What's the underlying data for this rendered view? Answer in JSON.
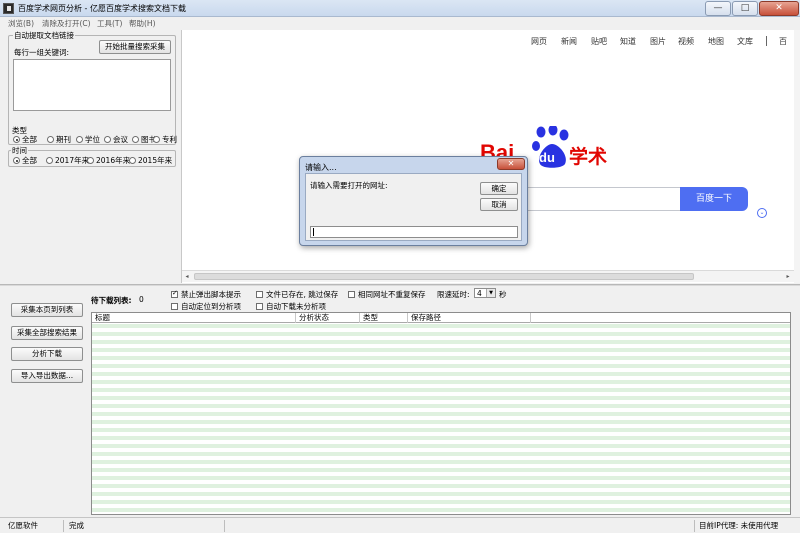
{
  "window": {
    "title": "百度学术网页分析 - 亿愿百度学术搜索文档下载",
    "minimize_glyph": "—",
    "maximize_glyph": "□",
    "close_glyph": "✕"
  },
  "menu": {
    "items": [
      "浏览(B)",
      "清除及打开(C)",
      "工具(T)",
      "帮助(H)"
    ]
  },
  "keyword_group": {
    "title": "自动提取文档链接",
    "label": "每行一组关键词:",
    "start_button": "开始批量搜索采集",
    "keywords_value": ""
  },
  "type_group": {
    "title": "类型",
    "options": [
      "全部",
      "期刊",
      "学位",
      "会议",
      "图书",
      "专利"
    ],
    "selected": "全部"
  },
  "time_group": {
    "title": "时间",
    "options": [
      "全部",
      "2017年来",
      "2016年来",
      "2015年来"
    ],
    "selected": "全部"
  },
  "browser": {
    "nav_links": [
      "网页",
      "新闻",
      "贴吧",
      "知道",
      "图片",
      "视频",
      "地图",
      "文库"
    ],
    "search_button": "百度一下",
    "logo_text_left": "Bai",
    "logo_text_paw": "du",
    "logo_text_right": "学术",
    "cut_link": "百"
  },
  "dialog": {
    "title": "请输入...",
    "prompt": "请输入需要打开的网址:",
    "ok": "确定",
    "cancel": "取消",
    "url_value": ""
  },
  "bottom": {
    "pending_label": "待下载列表:",
    "pending_count": "0",
    "buttons": [
      "采集本页到列表",
      "采集全部搜索结果",
      "分析下载",
      "导入导出数据..."
    ],
    "checkboxes": [
      {
        "label": "禁止弹出脚本提示",
        "checked": true
      },
      {
        "label": "文件已存在, 跳过保存",
        "checked": false
      },
      {
        "label": "相同网址不重复保存",
        "checked": false
      },
      {
        "label": "自动定位到分析项",
        "checked": false
      },
      {
        "label": "自动下载未分析项",
        "checked": false
      }
    ],
    "delay_label": "限速延时:",
    "delay_value": "4",
    "delay_unit": "秒",
    "columns": [
      "标题",
      "分析状态",
      "类型",
      "保存路径"
    ]
  },
  "status": {
    "app": "亿愿软件",
    "state": "完成",
    "proxy": "目前IP代理: 未使用代理"
  }
}
